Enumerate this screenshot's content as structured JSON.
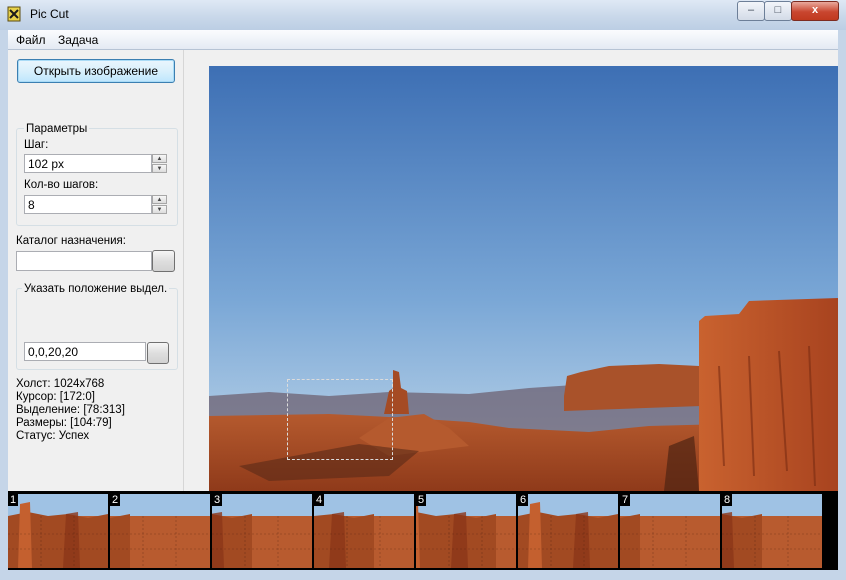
{
  "window": {
    "title": "Pic Cut"
  },
  "controls": {
    "minimize": "–",
    "maximize": "□",
    "close": "x"
  },
  "menu": [
    {
      "label": "Файл"
    },
    {
      "label": "Задача"
    }
  ],
  "toolbar": {
    "open_image_label": "Открыть изображение"
  },
  "params": {
    "group_label": "Параметры",
    "step_label": "Шаг:",
    "step_value": "102 px",
    "steps_count_label": "Кол-во шагов:",
    "steps_count_value": "8"
  },
  "destination": {
    "label": "Каталог назначения:",
    "value": ""
  },
  "selection_pos": {
    "group_label": "Указать положение выдел.",
    "value": "0,0,20,20"
  },
  "status": {
    "canvas": "Холст: 1024x768",
    "cursor": "Курсор: [172:0]",
    "selection": "Выделение: [78:313]",
    "sizes": "Размеры: [104:79]",
    "state": "Статус: Успех"
  },
  "thumbnails": [
    {
      "number": "1"
    },
    {
      "number": "2"
    },
    {
      "number": "3"
    },
    {
      "number": "4"
    },
    {
      "number": "5"
    },
    {
      "number": "6"
    },
    {
      "number": "7"
    },
    {
      "number": "8"
    }
  ],
  "colors": {
    "sky_top": "#3d6fb4",
    "sky_bottom": "#b9d4ea",
    "rock": "#b8502a",
    "accent": "#3c7fb1"
  }
}
